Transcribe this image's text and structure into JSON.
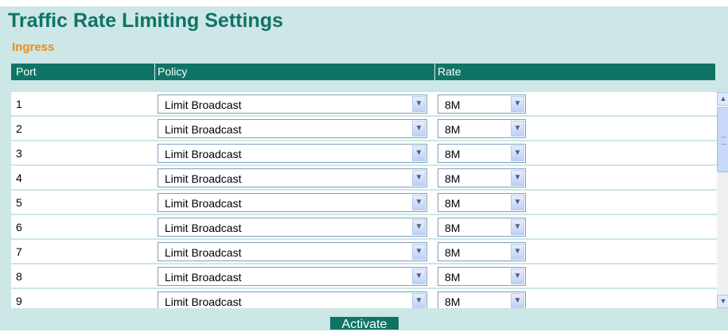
{
  "page": {
    "title": "Traffic Rate Limiting Settings",
    "subtitle": "Ingress"
  },
  "table": {
    "headers": {
      "port": "Port",
      "policy": "Policy",
      "rate": "Rate"
    },
    "rows": [
      {
        "port": "1",
        "policy": "Limit Broadcast",
        "rate": "8M"
      },
      {
        "port": "2",
        "policy": "Limit Broadcast",
        "rate": "8M"
      },
      {
        "port": "3",
        "policy": "Limit Broadcast",
        "rate": "8M"
      },
      {
        "port": "4",
        "policy": "Limit Broadcast",
        "rate": "8M"
      },
      {
        "port": "5",
        "policy": "Limit Broadcast",
        "rate": "8M"
      },
      {
        "port": "6",
        "policy": "Limit Broadcast",
        "rate": "8M"
      },
      {
        "port": "7",
        "policy": "Limit Broadcast",
        "rate": "8M"
      },
      {
        "port": "8",
        "policy": "Limit Broadcast",
        "rate": "8M"
      },
      {
        "port": "9",
        "policy": "Limit Broadcast",
        "rate": "8M"
      }
    ]
  },
  "actions": {
    "activate_label": "Activate"
  },
  "icons": {
    "dropdown": "chevron-down-icon",
    "scroll_up": "scroll-up-icon",
    "scroll_down": "scroll-down-icon"
  },
  "colors": {
    "accent": "#0f7466",
    "title": "#0e7466",
    "subtitle": "#ef8b10",
    "panel": "#cde6e6"
  }
}
